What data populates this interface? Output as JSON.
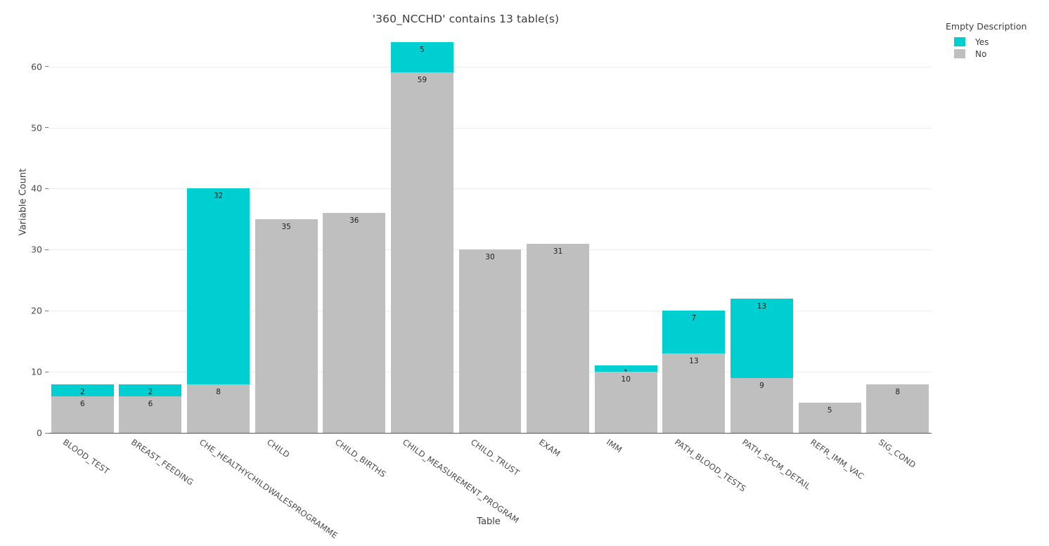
{
  "chart_data": {
    "type": "bar",
    "barmode": "stacked",
    "title": "'360_NCCHD' contains 13 table(s)",
    "xlabel": "Table",
    "ylabel": "Variable Count",
    "ylim": [
      0,
      64.8
    ],
    "yticks": [
      0,
      10,
      20,
      30,
      40,
      50,
      60
    ],
    "grid": "horizontal",
    "legend": {
      "title": "Empty Description",
      "position": "top-right",
      "entries": [
        {
          "label": "Yes",
          "color": "#00cfd1"
        },
        {
          "label": "No",
          "color": "#bfbfbf"
        }
      ]
    },
    "categories": [
      "BLOOD_TEST",
      "BREAST_FEEDING",
      "CHE_HEALTHYCHILDWALESPROGRAMME",
      "CHILD",
      "CHILD_BIRTHS",
      "CHILD_MEASUREMENT_PROGRAM",
      "CHILD_TRUST",
      "EXAM",
      "IMM",
      "PATH_BLOOD_TESTS",
      "PATH_SPCM_DETAIL",
      "REFR_IMM_VAC",
      "SIG_COND"
    ],
    "series": [
      {
        "name": "No",
        "color": "#bfbfbf",
        "values": [
          6,
          6,
          8,
          35,
          36,
          59,
          30,
          31,
          10,
          13,
          9,
          5,
          8
        ]
      },
      {
        "name": "Yes",
        "color": "#00cfd1",
        "values": [
          2,
          2,
          32,
          0,
          0,
          5,
          0,
          0,
          1,
          7,
          13,
          0,
          0
        ]
      }
    ],
    "totals": [
      8,
      8,
      40,
      35,
      36,
      64,
      30,
      31,
      11,
      20,
      22,
      5,
      8
    ]
  },
  "colors": {
    "yes": "#00cfd1",
    "no": "#bfbfbf",
    "axis": "#555555",
    "grid": "#ededed",
    "text": "#3c3c3c"
  }
}
